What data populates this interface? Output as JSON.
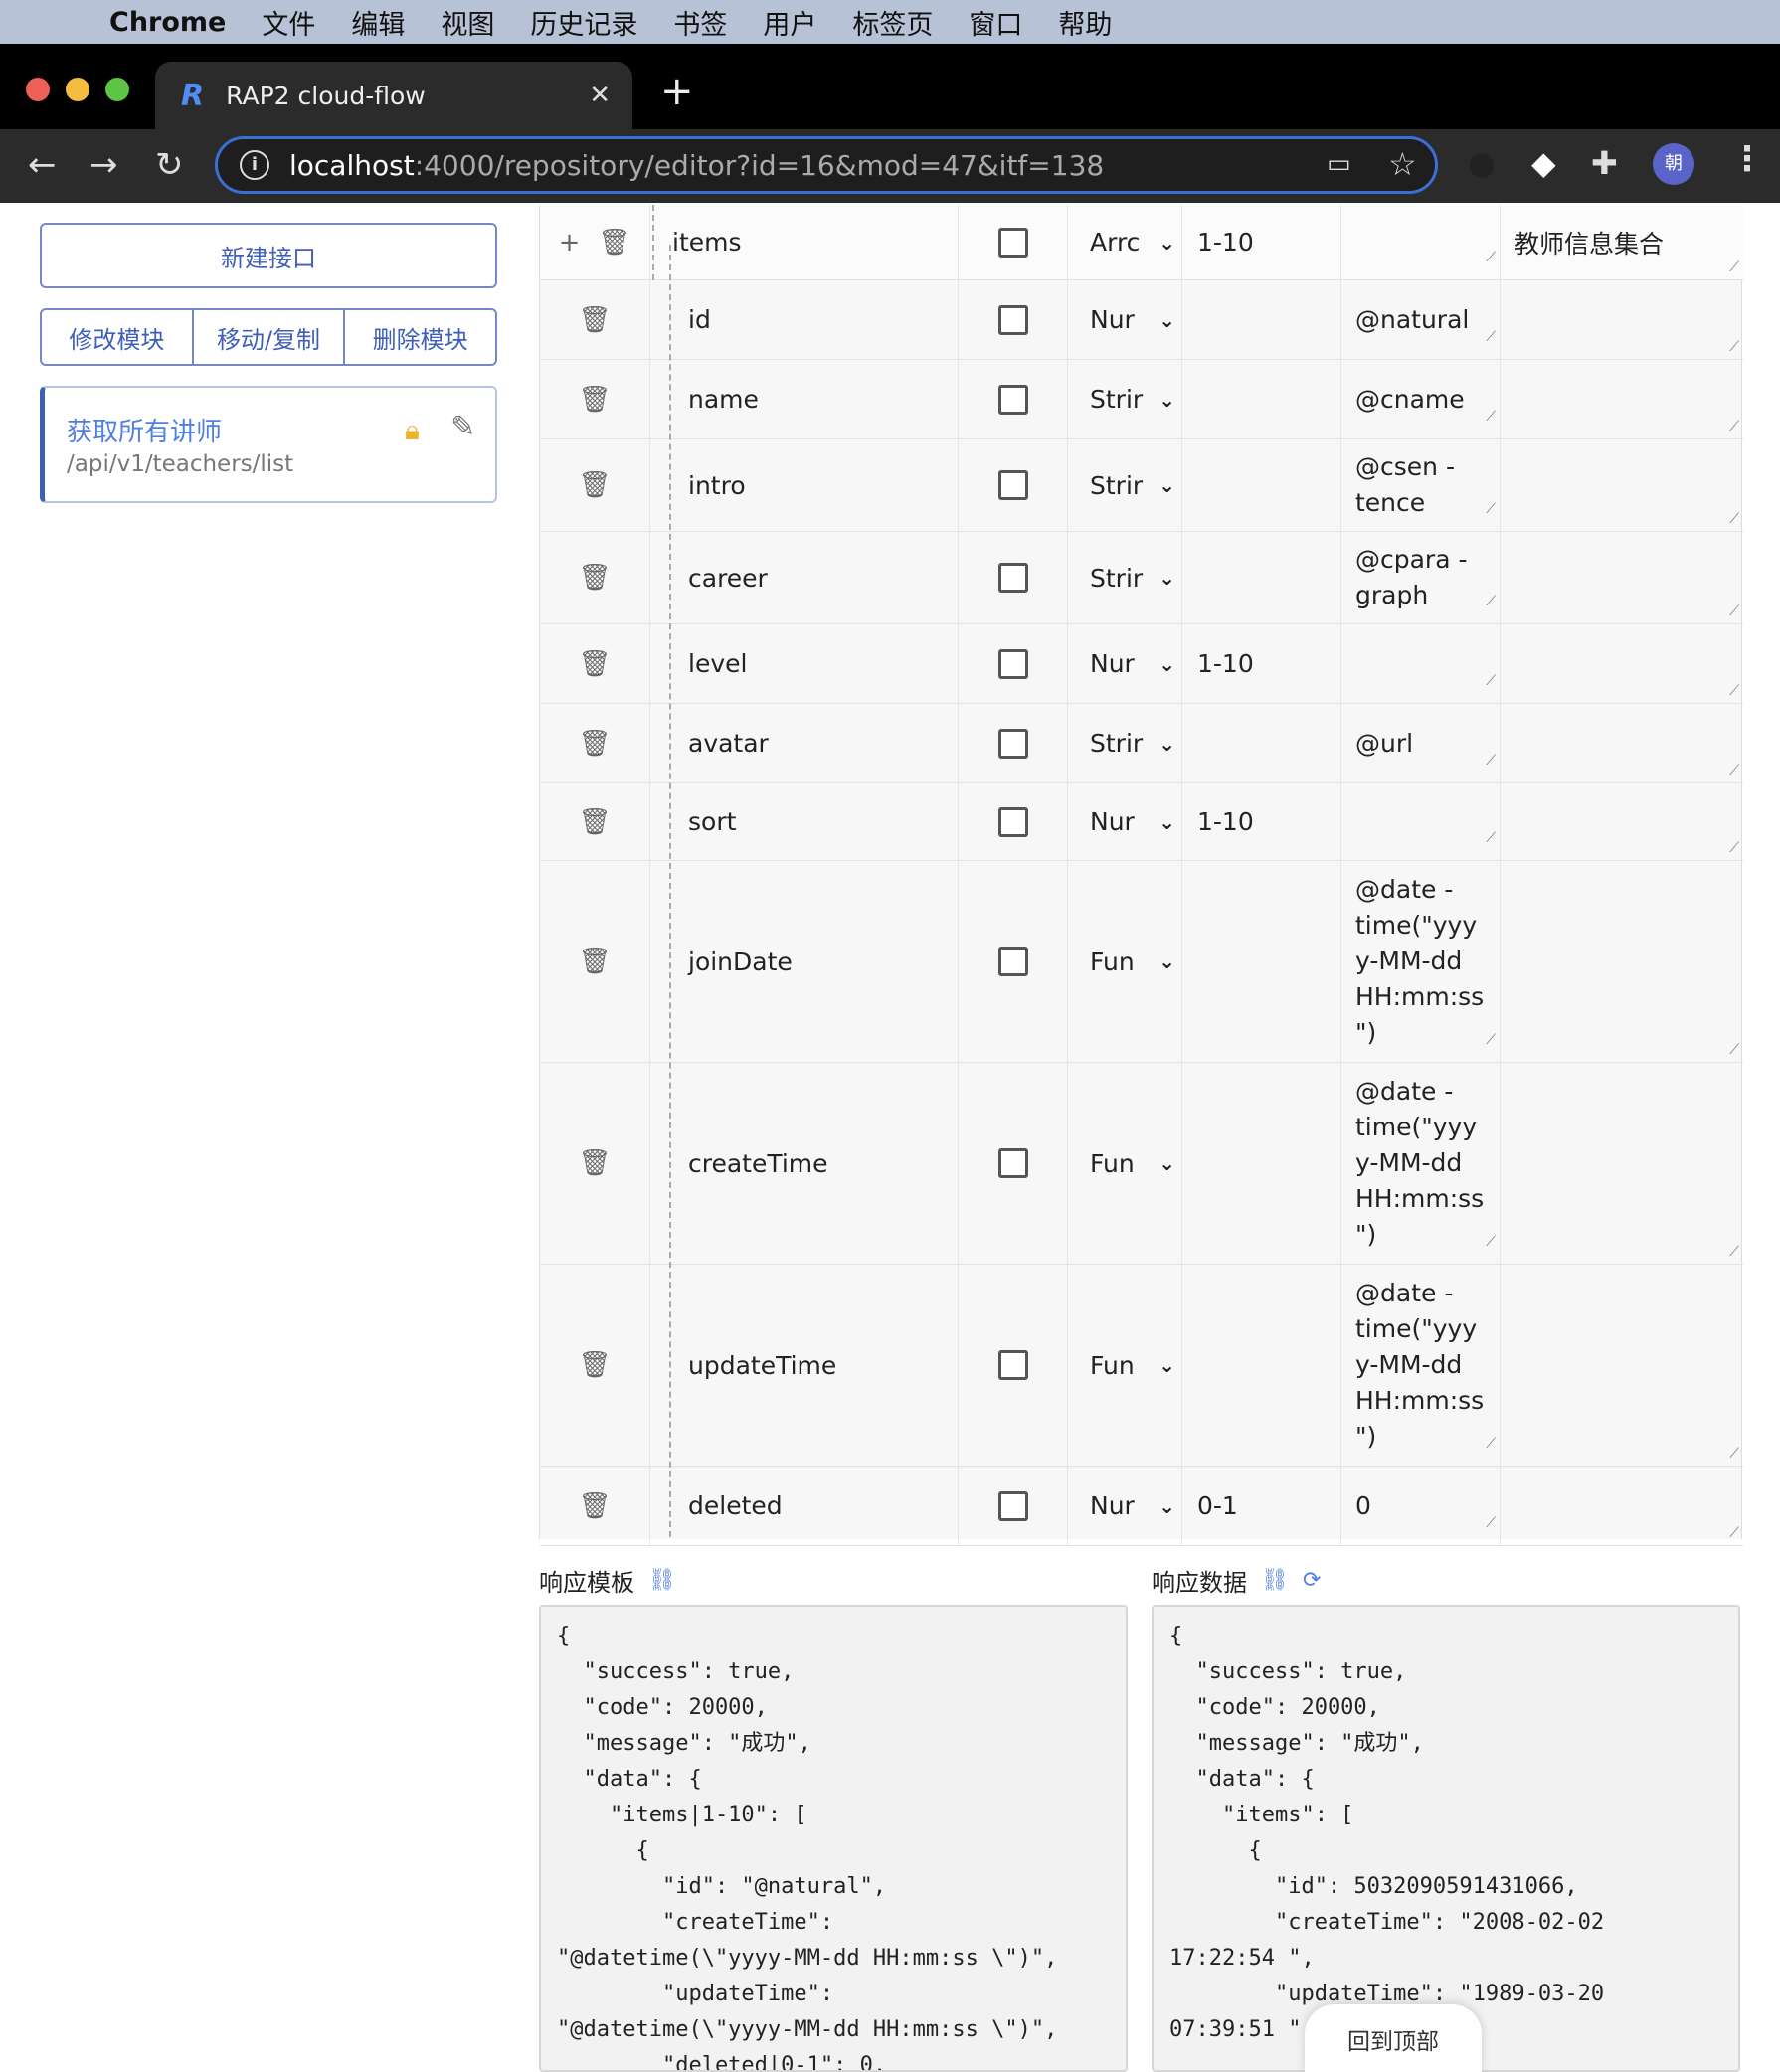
{
  "menubar": {
    "app": "Chrome",
    "items": [
      "文件",
      "编辑",
      "视图",
      "历史记录",
      "书签",
      "用户",
      "标签页",
      "窗口",
      "帮助"
    ]
  },
  "tab": {
    "title": "RAP2 cloud-flow",
    "favicon": "R"
  },
  "omnibox": {
    "host": "localhost",
    "rest": ":4000/repository/editor?id=16&mod=47&itf=138"
  },
  "profile": {
    "initial": "朝"
  },
  "sidebar": {
    "new_interface": "新建接口",
    "module_actions": [
      "修改模块",
      "移动/复制",
      "删除模块"
    ],
    "interface": {
      "name": "获取所有讲师",
      "path": "/api/v1/teachers/list"
    }
  },
  "properties": [
    {
      "name": "items",
      "type": "Arrc",
      "rule": "1-10",
      "value": "",
      "desc": "教师信息集合",
      "head": true
    },
    {
      "name": "id",
      "type": "Nur",
      "rule": "",
      "value": "@natural",
      "desc": ""
    },
    {
      "name": "name",
      "type": "Strir",
      "rule": "",
      "value": "@cname",
      "desc": ""
    },
    {
      "name": "intro",
      "type": "Strir",
      "rule": "",
      "value": "@csen - tence",
      "desc": ""
    },
    {
      "name": "career",
      "type": "Strir",
      "rule": "",
      "value": "@cpara - graph",
      "desc": ""
    },
    {
      "name": "level",
      "type": "Nur",
      "rule": "1-10",
      "value": "",
      "desc": ""
    },
    {
      "name": "avatar",
      "type": "Strir",
      "rule": "",
      "value": "@url",
      "desc": ""
    },
    {
      "name": "sort",
      "type": "Nur",
      "rule": "1-10",
      "value": "",
      "desc": ""
    },
    {
      "name": "joinDate",
      "type": "Fun",
      "rule": "",
      "value": "@date - time(\"yyyy-MM-dd HH:mm:ss \")",
      "desc": ""
    },
    {
      "name": "createTime",
      "type": "Fun",
      "rule": "",
      "value": "@date - time(\"yyyy-MM-dd HH:mm:ss \")",
      "desc": ""
    },
    {
      "name": "updateTime",
      "type": "Fun",
      "rule": "",
      "value": "@date - time(\"yyyy-MM-dd HH:mm:ss \")",
      "desc": ""
    },
    {
      "name": "deleted",
      "type": "Nur",
      "rule": "0-1",
      "value": "0",
      "desc": ""
    }
  ],
  "response": {
    "template_label": "响应模板",
    "data_label": "响应数据",
    "template_code": "{\n  \"success\": true,\n  \"code\": 20000,\n  \"message\": \"成功\",\n  \"data\": {\n    \"items|1-10\": [\n      {\n        \"id\": \"@natural\",\n        \"createTime\":\n\"@datetime(\\\"yyyy-MM-dd HH:mm:ss \\\")\",\n        \"updateTime\":\n\"@datetime(\\\"yyyy-MM-dd HH:mm:ss \\\")\",\n        \"deleted|0-1\": 0,",
    "data_code": "{\n  \"success\": true,\n  \"code\": 20000,\n  \"message\": \"成功\",\n  \"data\": {\n    \"items\": [\n      {\n        \"id\": 5032090591431066,\n        \"createTime\": \"2008-02-02\n17:22:54 \",\n        \"updateTime\": \"1989-03-20\n07:39:51 \","
  },
  "back_to_top": "回到顶部"
}
